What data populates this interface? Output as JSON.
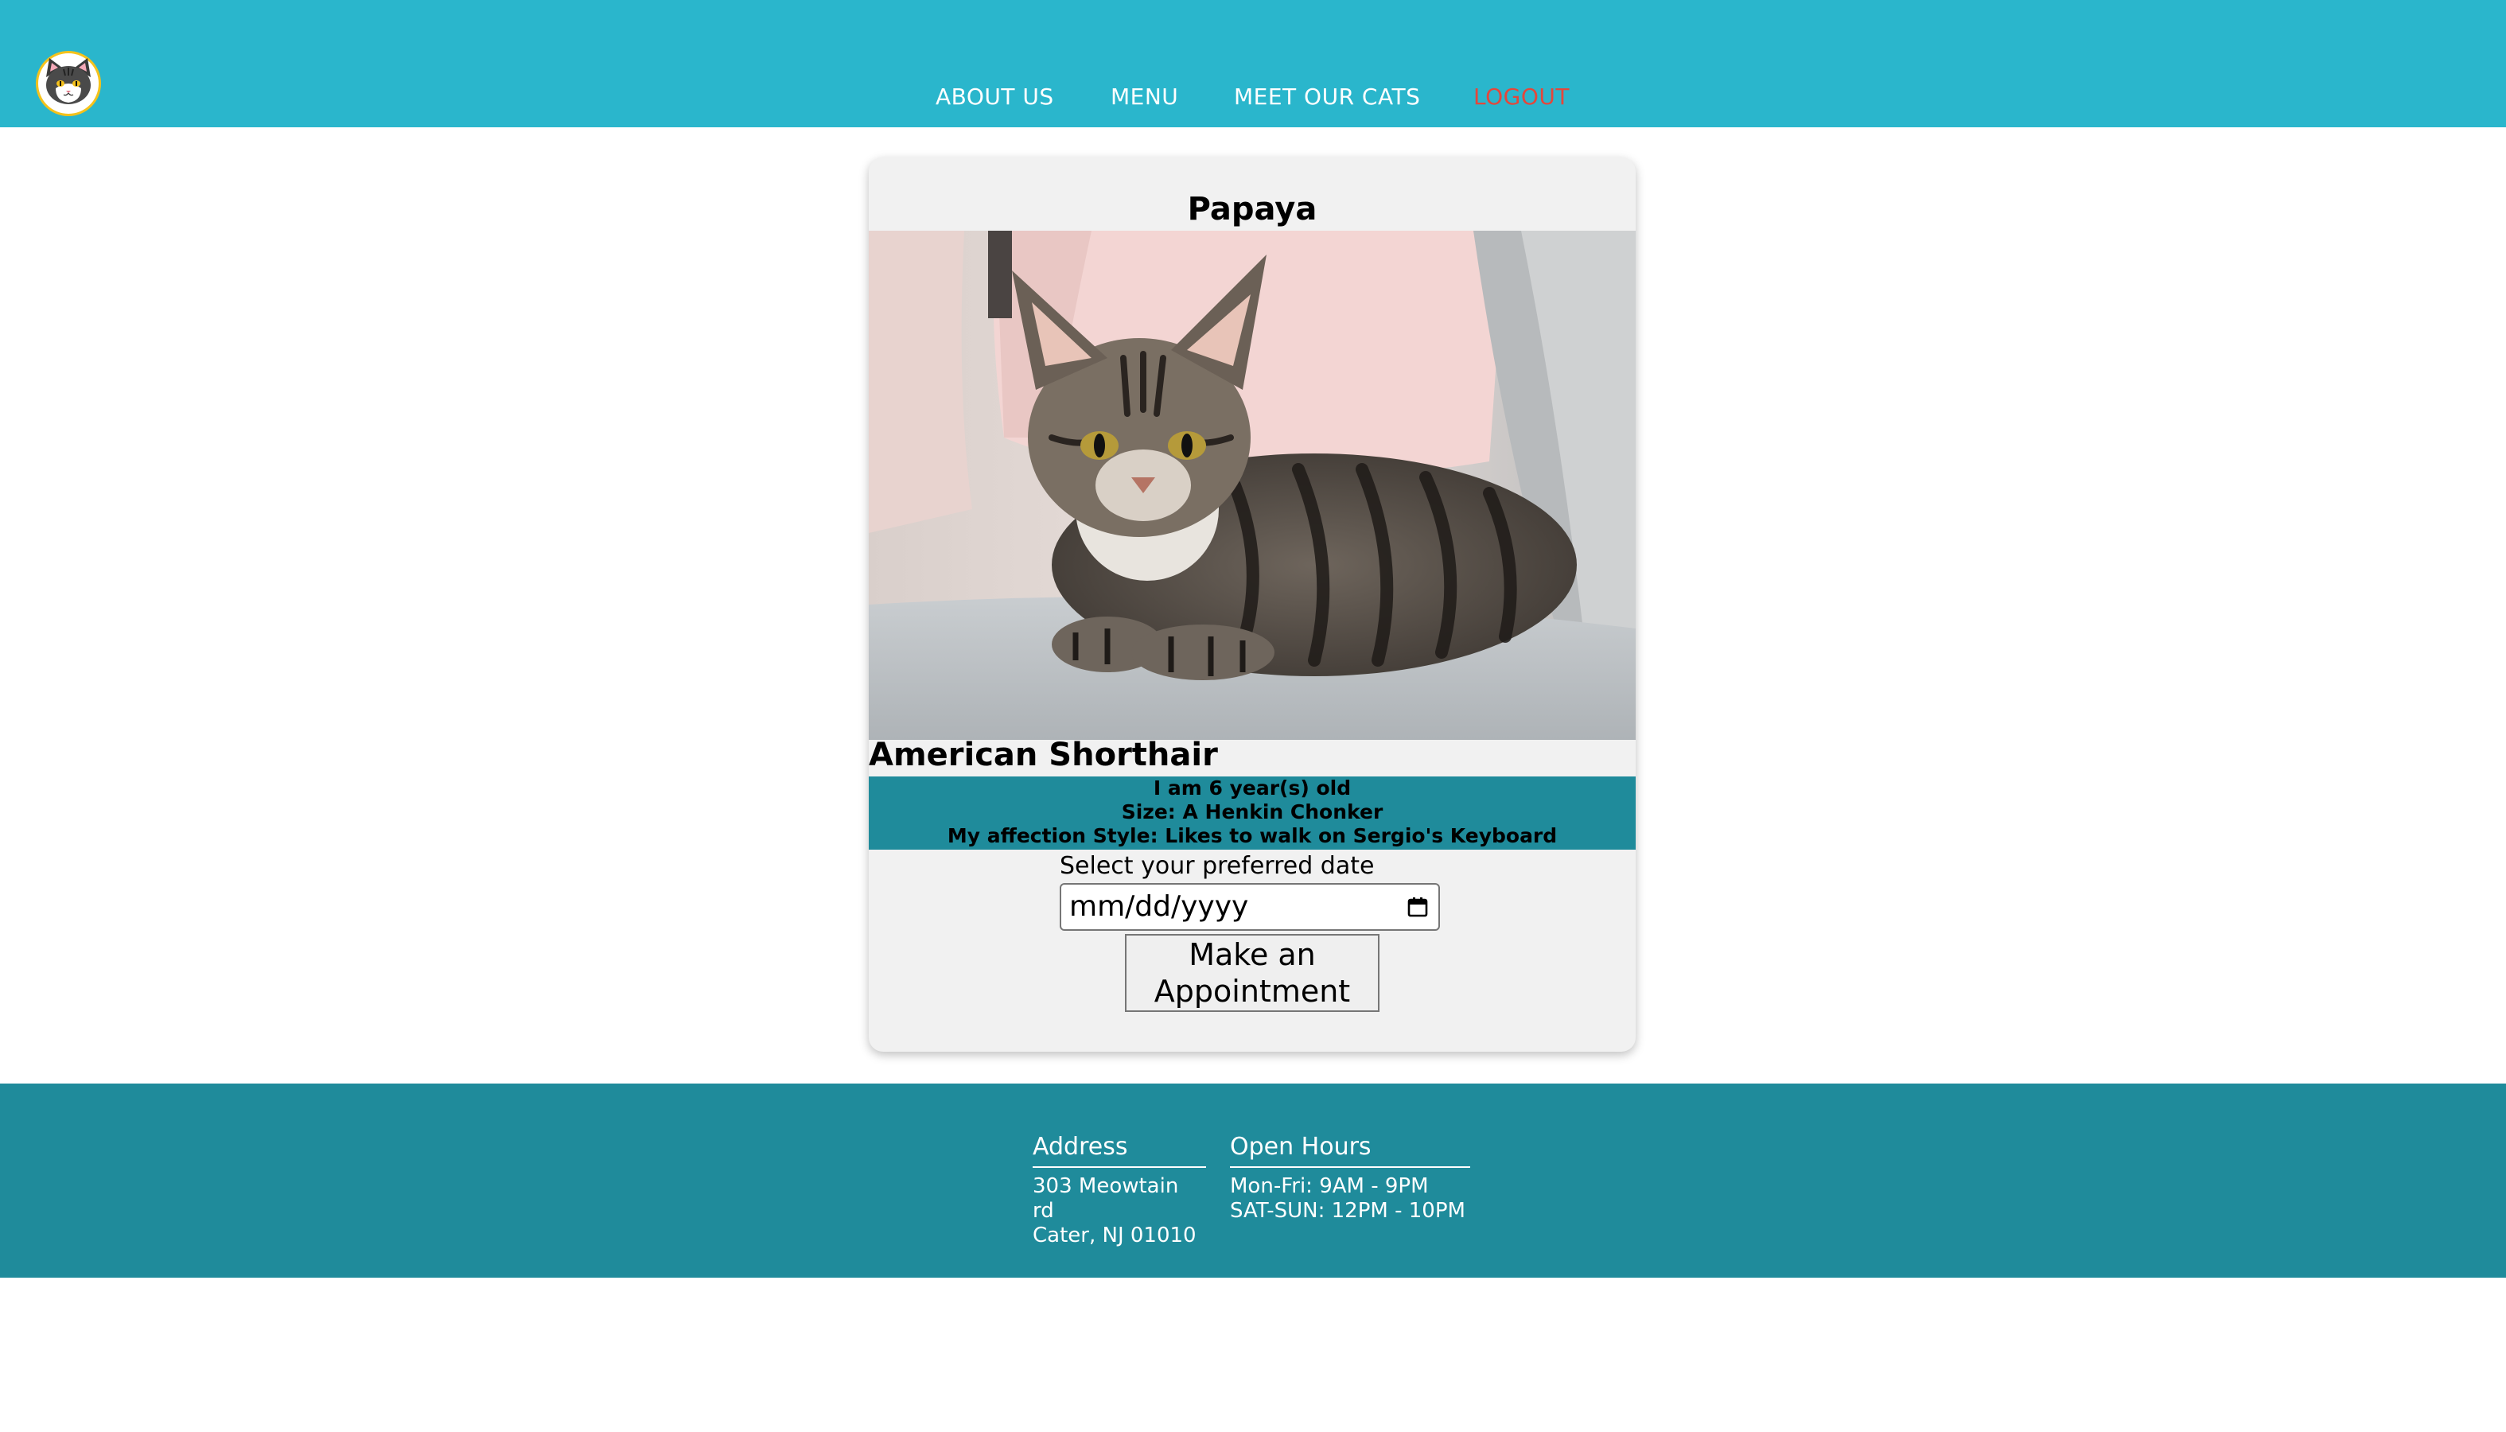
{
  "nav": {
    "items": [
      {
        "label": "ABOUT US"
      },
      {
        "label": "MENU"
      },
      {
        "label": "MEET OUR CATS"
      },
      {
        "label": "LOGOUT"
      }
    ],
    "logout_color": "#e4473b"
  },
  "brand": {
    "logo_icon": "cat-face-icon"
  },
  "card": {
    "name": "Papaya",
    "photo_icon": "tabby-cat-photo",
    "breed": "American Shorthair",
    "info": [
      "I am 6 year(s) old",
      "Size: A Henkin Chonker",
      "My affection Style: Likes to walk on Sergio's Keyboard"
    ],
    "date_label": "Select your preferred date",
    "date_placeholder": "mm/dd/yyyy",
    "button_label": "Make an Appointment"
  },
  "footer": {
    "address": {
      "heading": "Address",
      "lines": [
        "303 Meowtain rd",
        "Cater, NJ 01010"
      ]
    },
    "hours": {
      "heading": "Open Hours",
      "lines": [
        "Mon-Fri: 9AM - 9PM",
        "SAT-SUN: 12PM - 10PM"
      ]
    }
  },
  "colors": {
    "header_bg": "#2ab6cc",
    "footer_bg": "#1f8b9b",
    "info_bg": "#1f8b9b",
    "card_bg": "#f1f1f1"
  }
}
